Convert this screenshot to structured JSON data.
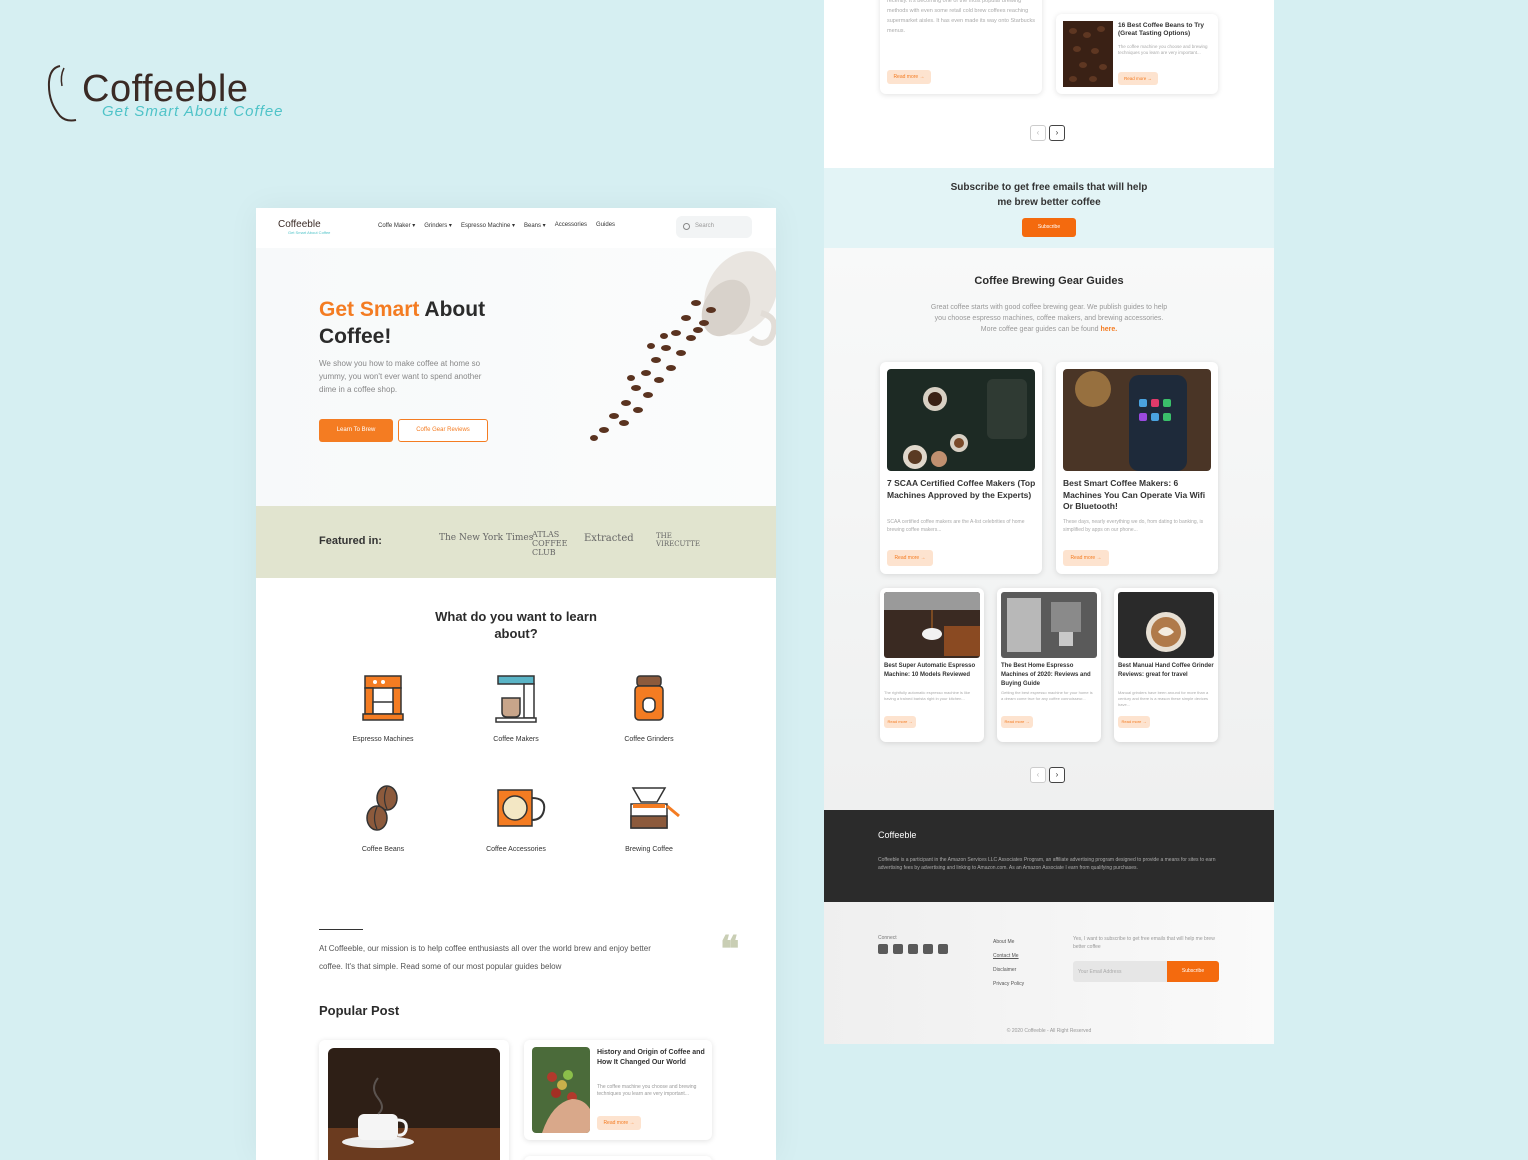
{
  "brand": {
    "name": "Coffeeble",
    "tagline": "Get Smart About Coffee"
  },
  "colors": {
    "background": "#d6eff2",
    "accent": "#f47c22",
    "featured_bg": "#e1e4cf",
    "footer_dark": "#2b2b2b"
  },
  "left_page": {
    "nav": {
      "logo": "Coffeeble",
      "logo_sub": "Get Smart About Coffee",
      "items": [
        "Coffe Maker ▾",
        "Grinders ▾",
        "Espresso Machine ▾",
        "Beans ▾",
        "Accessories",
        "Guides"
      ],
      "search_placeholder": "Search"
    },
    "hero": {
      "title_accent": "Get Smart",
      "title_rest": " About Coffee!",
      "description": "We show you how to make coffee at home so yummy, you won't ever want to spend another dime in a coffee shop.",
      "primary_button": "Learn To Brew",
      "secondary_button": "Coffe Gear Reviews"
    },
    "featured": {
      "label": "Featured in:",
      "logos": [
        "The New York Times",
        "ATLAS COFFEE CLUB",
        "Extracted",
        "THE VIRECUTTE"
      ]
    },
    "learn": {
      "title": "What do you want to learn about?",
      "categories": [
        {
          "label": "Espresso Machines",
          "icon": "espresso-machine-icon"
        },
        {
          "label": "Coffee Makers",
          "icon": "coffee-maker-icon"
        },
        {
          "label": "Coffee Grinders",
          "icon": "coffee-grinder-icon"
        },
        {
          "label": "Coffee Beans",
          "icon": "coffee-beans-icon"
        },
        {
          "label": "Coffee Accessories",
          "icon": "coffee-accessories-icon"
        },
        {
          "label": "Brewing Coffee",
          "icon": "brewing-coffee-icon"
        }
      ]
    },
    "mission": "At Coffeeble, our mission is to help coffee enthusiasts all over the world brew and enjoy better coffee. It's that simple. Read some of our most popular guides below",
    "popular": {
      "title": "Popular Post",
      "side_post": {
        "title": "History and Origin of Coffee and How It Changed Our World",
        "description": "The coffee machine you choose and brewing techniques you learn are very important...",
        "read_more": "Read more →"
      }
    }
  },
  "right_page": {
    "top_cards": [
      {
        "description": "recently. It's becoming one of the most popular brewing methods with even some retail cold brew coffees reaching supermarket aisles. It has even made its way onto Starbucks menus.",
        "read_more": "Read more →"
      },
      {
        "title": "16 Best Coffee Beans to Try (Great Tasting Options)",
        "description": "The coffee machine you choose and brewing techniques you learn are very important...",
        "read_more": "Read more →"
      }
    ],
    "pager": [
      "‹",
      "›"
    ],
    "subscribe": {
      "text": "Subscribe to get free emails that will help me brew better coffee",
      "button": "Subscribe"
    },
    "gear": {
      "title": "Coffee Brewing Gear Guides",
      "description": "Great coffee starts with good coffee brewing gear. We publish guides to help you choose espresso machines, coffee makers, and brewing accessories. More coffee gear guides can be found ",
      "link": "here.",
      "large_cards": [
        {
          "title": "7 SCAA Certified Coffee Makers (Top Machines Approved by the Experts)",
          "description": "SCAA certified coffee makers are the A-list celebrities of home brewing coffee makers...",
          "read_more": "Read more →"
        },
        {
          "title": "Best Smart Coffee Makers: 6 Machines You Can Operate Via Wifi Or Bluetooth!",
          "description": "These days, nearly everything we do, from dating to banking, is simplified by apps on our phone...",
          "read_more": "Read more →"
        }
      ],
      "small_cards": [
        {
          "title": "Best Super Automatic Espresso Machine: 10 Models Reviewed",
          "description": "The rightfully automatic espresso machine is like having a trained barista right in your kitchen...",
          "read_more": "Read more →"
        },
        {
          "title": "The Best Home Espresso Machines of 2020: Reviews and Buying Guide",
          "description": "Getting the best espresso machine for your home is a dream come true for any coffee connoisseur...",
          "read_more": "Read more →"
        },
        {
          "title": "Best Manual Hand Coffee Grinder Reviews: great for travel",
          "description": "Manual grinders have been around for more than a century and there is a reason these simple devices have...",
          "read_more": "Read more →"
        }
      ]
    },
    "footer": {
      "logo": "Coffeeble",
      "disclosure": "Coffeeble is a participant in the Amazon Services LLC Associates Program, an affiliate advertising program designed to provide a means for sites to earn advertising fees by advertising and linking to Amazon.com. As an Amazon Associate I earn from qualifying purchases.",
      "connect": "Connect",
      "social": [
        "facebook-icon",
        "youtube-icon",
        "twitter-icon",
        "instagram-icon",
        "pinterest-icon"
      ],
      "links": [
        "About Me",
        "Contact Me",
        "Disclaimer",
        "Privacy Policy"
      ],
      "subscribe_label": "Yes, I want to subscribe to get free emails that will help me brew better coffee",
      "email_placeholder": "Your Email Address",
      "subscribe_button": "Subscribe",
      "copyright": "© 2020 Coffeeble - All Right Reserved"
    }
  }
}
